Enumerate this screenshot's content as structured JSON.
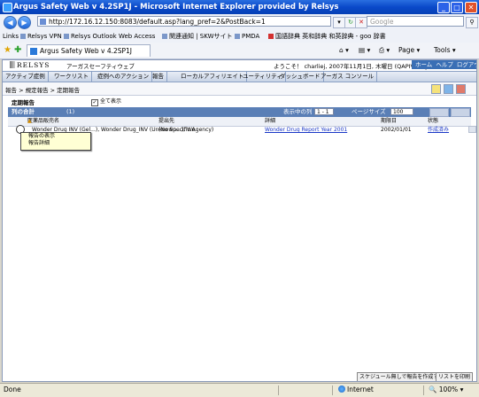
{
  "window": {
    "title": "Argus Safety Web v 4.2SP1J - Microsoft Internet Explorer provided by Relsys",
    "minimize": "_",
    "maximize": "□",
    "close": "✕"
  },
  "browser": {
    "back": "◀",
    "forward": "▶",
    "url": "http://172.16.12.150:8083/default.asp?lang_pref=2&PostBack=1",
    "search_placeholder": "Google",
    "links_label": "Links",
    "links": [
      "Relsys VPN",
      "Relsys Outlook Web Access",
      "関連通知 | SKWサイト",
      "PMDA",
      "国語辞典 英和辞典 和英辞典 - goo 辞書"
    ],
    "tab_title": "Argus Safety Web v 4.2SP1J",
    "page_menu": "Page ▾",
    "tools_menu": "Tools ▾"
  },
  "app": {
    "logo": "RELSYS",
    "name": "アーガスセーフティウェブ",
    "welcome": "ようこそ！ charliej, 2007年11月1日, 木曜日 (QAPIVRASJ)",
    "top_links": [
      "ホーム",
      "ヘルプ",
      "ログアウト"
    ],
    "menu": [
      "アクティブ症例",
      "ワークリスト",
      "症例へのアクション",
      "報告",
      "ローカルアフィリエイト",
      "ユーティリティ",
      "ダッシュボード",
      "アーガス コンソール"
    ],
    "breadcrumb": "報告 > 規定報告 > 定期報告"
  },
  "page": {
    "title": "定期報告",
    "show_all_label": "全て表示",
    "show_all_checked": true,
    "list_total_label": "列の合計",
    "list_total_count": "(1)",
    "showing_label": "表示中の列",
    "showing_value": "1 - 1",
    "page_size_label": "ページサイズ",
    "page_size_value": "100",
    "columns": [
      "医薬品販売名",
      "提出先",
      "詳細",
      "期限日",
      "状態"
    ],
    "rows": [
      {
        "product": "Wonder Drug INV (Gel...), Wonder Drug_INV (Unknown...), Wo",
        "submit_to": "(No Specific Agency)",
        "detail": "Wonder Drug Report Year 2001",
        "due_date": "2002/01/01",
        "status": "作成済み"
      }
    ],
    "context_menu": [
      "報告の表示",
      "報告詳細"
    ],
    "bottom_buttons": [
      "スケジュール無しで報告を作成する",
      "リストを印刷"
    ]
  },
  "status": {
    "left": "Done",
    "zone": "Internet",
    "zoom": "100%"
  }
}
